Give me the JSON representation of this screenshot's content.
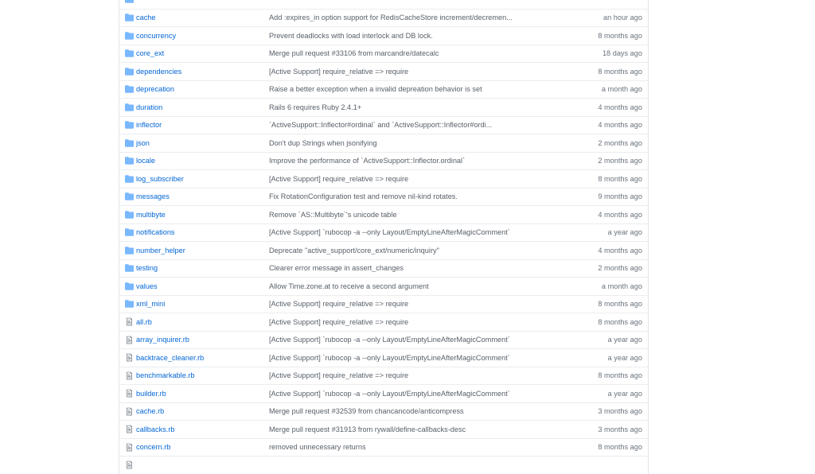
{
  "colors": {
    "folder_icon": "#79b8ff",
    "file_icon": "#6a737d",
    "link": "#0366d6",
    "muted": "#586069"
  },
  "rows": [
    {
      "type": "dir",
      "icon": "folder-icon",
      "name": "",
      "message": "",
      "age": ""
    },
    {
      "type": "dir",
      "icon": "folder-icon",
      "name": "cache",
      "message": "Add :expires_in option support for RedisCacheStore increment/decremen...",
      "age": "an hour ago"
    },
    {
      "type": "dir",
      "icon": "folder-icon",
      "name": "concurrency",
      "message": "Prevent deadlocks with load interlock and DB lock.",
      "age": "8 months ago"
    },
    {
      "type": "dir",
      "icon": "folder-icon",
      "name": "core_ext",
      "message": "Merge pull request #33106 from marcandre/datecalc",
      "age": "18 days ago"
    },
    {
      "type": "dir",
      "icon": "folder-icon",
      "name": "dependencies",
      "message": "[Active Support] require_relative => require",
      "age": "8 months ago"
    },
    {
      "type": "dir",
      "icon": "folder-icon",
      "name": "deprecation",
      "message": "Raise a better exception when a invalid depreation behavior is set",
      "age": "a month ago"
    },
    {
      "type": "dir",
      "icon": "folder-icon",
      "name": "duration",
      "message": "Rails 6 requires Ruby 2.4.1+",
      "age": "4 months ago"
    },
    {
      "type": "dir",
      "icon": "folder-icon",
      "name": "inflector",
      "message": "`ActiveSupport::Inflector#ordinal` and `ActiveSupport::Inflector#ordi...",
      "age": "4 months ago"
    },
    {
      "type": "dir",
      "icon": "folder-icon",
      "name": "json",
      "message": "Don't dup Strings when jsonifying",
      "age": "2 months ago"
    },
    {
      "type": "dir",
      "icon": "folder-icon",
      "name": "locale",
      "message": "Improve the performance of `ActiveSupport::Inflector.ordinal`",
      "age": "2 months ago"
    },
    {
      "type": "dir",
      "icon": "folder-icon",
      "name": "log_subscriber",
      "message": "[Active Support] require_relative => require",
      "age": "8 months ago"
    },
    {
      "type": "dir",
      "icon": "folder-icon",
      "name": "messages",
      "message": "Fix RotationConfiguration test and remove nil-kind rotates.",
      "age": "9 months ago"
    },
    {
      "type": "dir",
      "icon": "folder-icon",
      "name": "multibyte",
      "message": "Remove `AS::Multibyte`'s unicode table",
      "age": "4 months ago"
    },
    {
      "type": "dir",
      "icon": "folder-icon",
      "name": "notifications",
      "message": "[Active Support] `rubocop -a --only Layout/EmptyLineAfterMagicComment`",
      "age": "a year ago"
    },
    {
      "type": "dir",
      "icon": "folder-icon",
      "name": "number_helper",
      "message": "Deprecate \"active_support/core_ext/numeric/inquiry\"",
      "age": "4 months ago"
    },
    {
      "type": "dir",
      "icon": "folder-icon",
      "name": "testing",
      "message": "Clearer error message in assert_changes",
      "age": "2 months ago"
    },
    {
      "type": "dir",
      "icon": "folder-icon",
      "name": "values",
      "message": "Allow Time.zone.at to receive a second argument",
      "age": "a month ago"
    },
    {
      "type": "dir",
      "icon": "folder-icon",
      "name": "xml_mini",
      "message": "[Active Support] require_relative => require",
      "age": "8 months ago"
    },
    {
      "type": "file",
      "icon": "file-icon",
      "name": "all.rb",
      "message": "[Active Support] require_relative => require",
      "age": "8 months ago"
    },
    {
      "type": "file",
      "icon": "file-icon",
      "name": "array_inquirer.rb",
      "message": "[Active Support] `rubocop -a --only Layout/EmptyLineAfterMagicComment`",
      "age": "a year ago"
    },
    {
      "type": "file",
      "icon": "file-icon",
      "name": "backtrace_cleaner.rb",
      "message": "[Active Support] `rubocop -a --only Layout/EmptyLineAfterMagicComment`",
      "age": "a year ago"
    },
    {
      "type": "file",
      "icon": "file-icon",
      "name": "benchmarkable.rb",
      "message": "[Active Support] require_relative => require",
      "age": "8 months ago"
    },
    {
      "type": "file",
      "icon": "file-icon",
      "name": "builder.rb",
      "message": "[Active Support] `rubocop -a --only Layout/EmptyLineAfterMagicComment`",
      "age": "a year ago"
    },
    {
      "type": "file",
      "icon": "file-icon",
      "name": "cache.rb",
      "message": "Merge pull request #32539 from chancancode/anticompress",
      "age": "3 months ago"
    },
    {
      "type": "file",
      "icon": "file-icon",
      "name": "callbacks.rb",
      "message": "Merge pull request #31913 from rywall/define-callbacks-desc",
      "age": "3 months ago"
    },
    {
      "type": "file",
      "icon": "file-icon",
      "name": "concern.rb",
      "message": "removed unnecessary returns",
      "age": "8 months ago"
    },
    {
      "type": "file",
      "icon": "file-icon",
      "name": "",
      "message": "",
      "age": ""
    }
  ]
}
